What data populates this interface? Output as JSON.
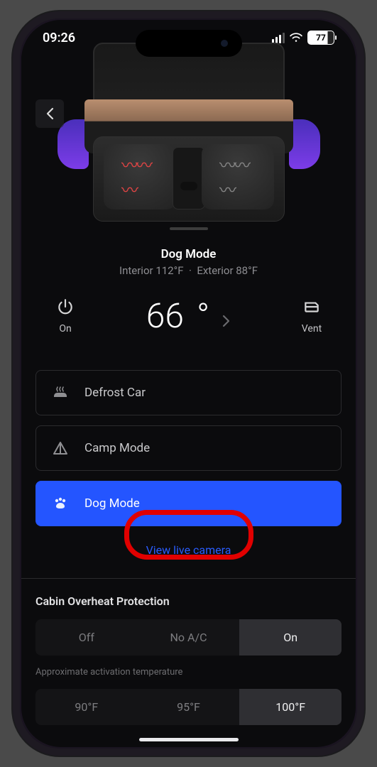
{
  "statusbar": {
    "time": "09:26",
    "battery_pct": "77"
  },
  "mode": {
    "title": "Dog Mode",
    "interior_label": "Interior 112°F",
    "dot": "·",
    "exterior_label": "Exterior 88°F"
  },
  "controls": {
    "power_label": "On",
    "setpoint": "66",
    "degree": "°",
    "vent_label": "Vent"
  },
  "options": {
    "defrost": "Defrost Car",
    "camp": "Camp Mode",
    "dog": "Dog Mode"
  },
  "live_camera": "View live camera",
  "overheat": {
    "title": "Cabin Overheat Protection",
    "off": "Off",
    "noac": "No A/C",
    "on": "On",
    "hint": "Approximate activation temperature",
    "t90": "90°F",
    "t95": "95°F",
    "t100": "100°F"
  }
}
